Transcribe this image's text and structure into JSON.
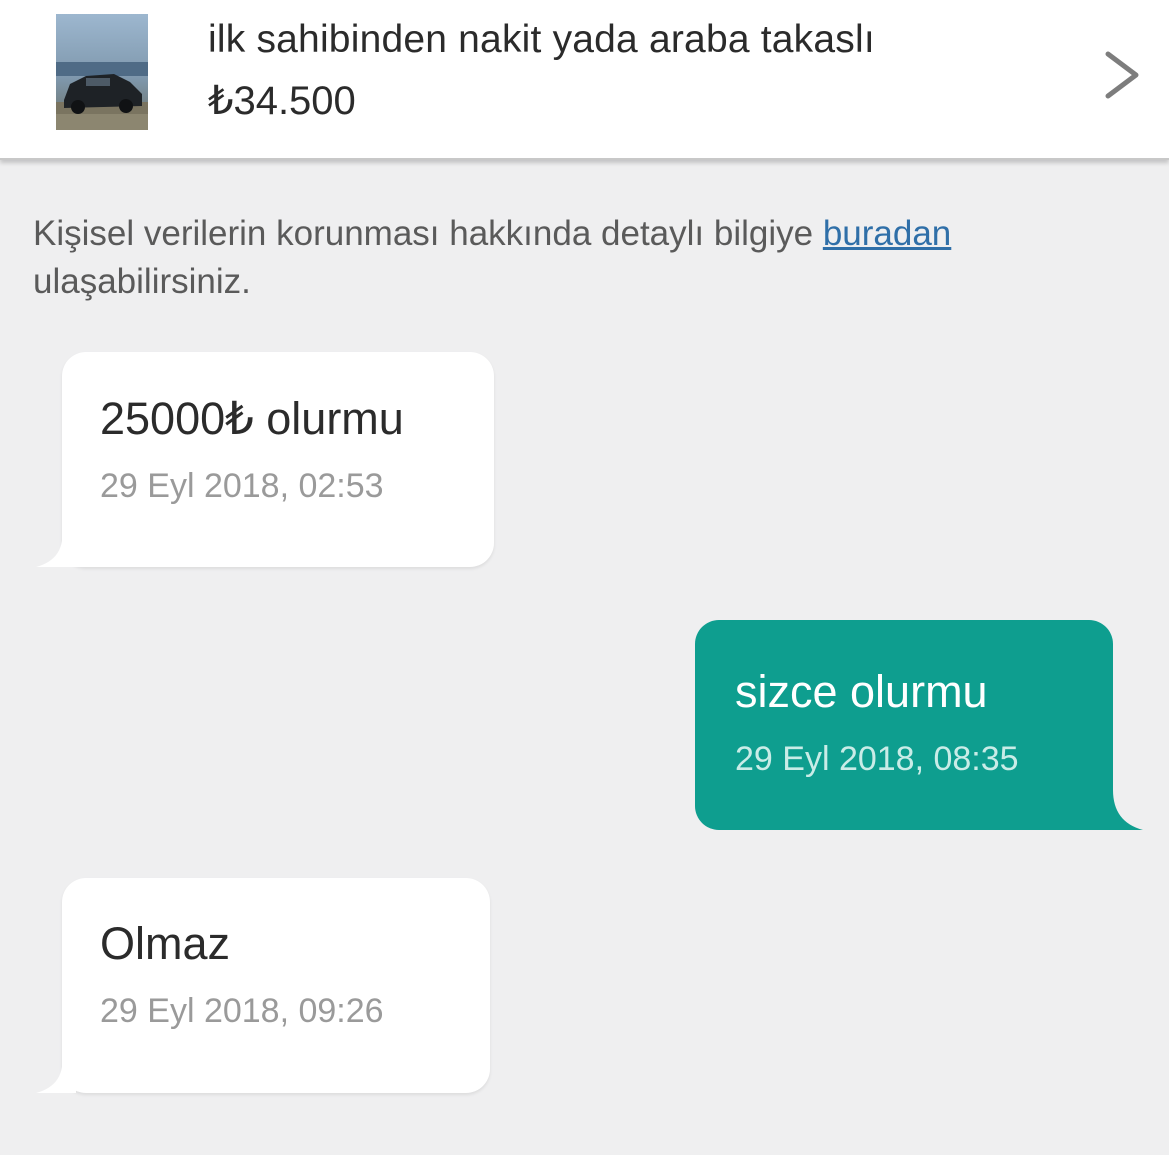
{
  "listing": {
    "title": "ilk sahibinden nakit yada araba takaslı",
    "price": "₺34.500",
    "thumbnail_icon": "car-photo",
    "chevron_icon": "chevron-right-icon"
  },
  "privacy_notice": {
    "text": "Kişisel verilerin korunması hakkında detaylı bilgiye",
    "link_text": "buradan",
    "suffix": "ulaşabilirsiniz."
  },
  "messages": [
    {
      "direction": "incoming",
      "text": "25000₺ olurmu",
      "time": "29 Eyl 2018, 02:53"
    },
    {
      "direction": "outgoing",
      "text": "sizce olurmu",
      "time": "29 Eyl 2018, 08:35"
    },
    {
      "direction": "incoming",
      "text": "Olmaz",
      "time": "29 Eyl 2018, 09:26"
    }
  ],
  "colors": {
    "background": "#efeff0",
    "incoming_bubble": "#ffffff",
    "outgoing_bubble": "#0e9e8f",
    "link": "#2f6fa8"
  }
}
